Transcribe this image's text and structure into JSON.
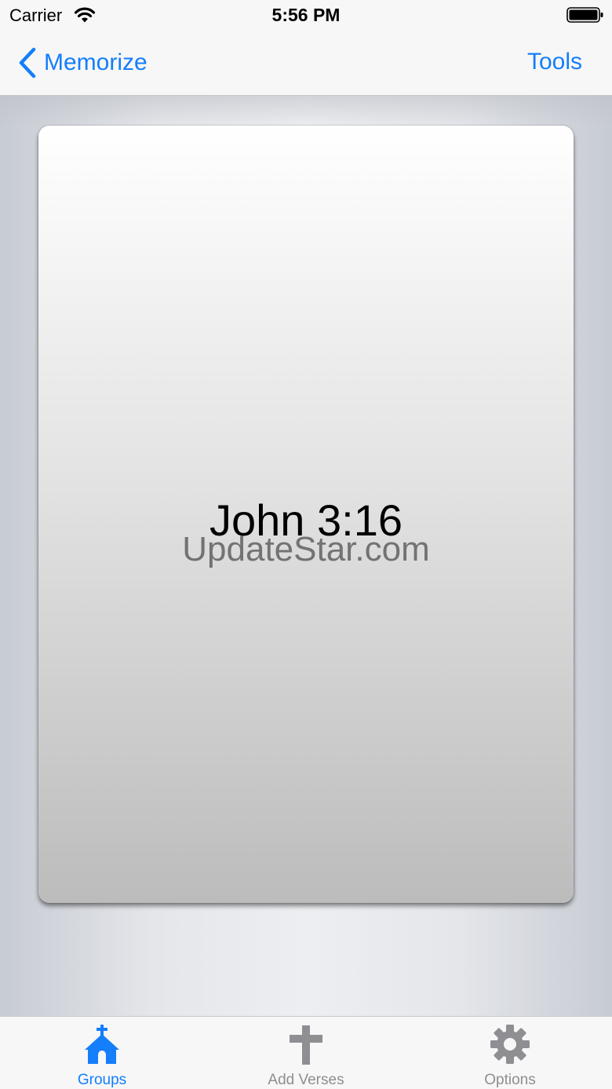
{
  "status_bar": {
    "carrier": "Carrier",
    "time": "5:56 PM"
  },
  "nav": {
    "back_label": "Memorize",
    "right_label": "Tools"
  },
  "card": {
    "reference": "John 3:16",
    "watermark": "UpdateStar.com"
  },
  "tabs": [
    {
      "label": "Groups",
      "icon": "church-icon",
      "selected": true
    },
    {
      "label": "Add Verses",
      "icon": "cross-icon",
      "selected": false
    },
    {
      "label": "Options",
      "icon": "gear-icon",
      "selected": false
    }
  ],
  "colors": {
    "accent": "#147efb",
    "inactive": "#8e8e93"
  }
}
